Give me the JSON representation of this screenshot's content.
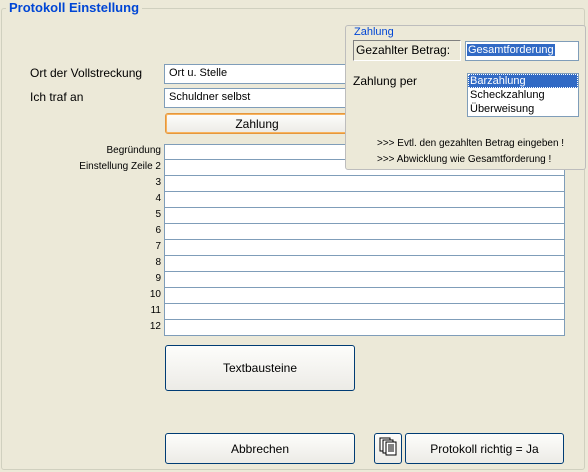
{
  "frame": {
    "title": "Protokoll Einstellung"
  },
  "form": {
    "ort_label": "Ort der Vollstreckung",
    "ort_value": "Ort u. Stelle",
    "traf_label": "Ich traf an",
    "traf_value": "Schuldner selbst",
    "zahlung_button": "Zahlung"
  },
  "lines": {
    "labels": [
      "Begründung",
      "Einstellung Zeile 2",
      "3",
      "4",
      "5",
      "6",
      "7",
      "8",
      "9",
      "10",
      "11",
      "12"
    ]
  },
  "buttons": {
    "textbausteine": "Textbausteine",
    "abbrechen": "Abbrechen",
    "protokoll": "Protokoll richtig = Ja"
  },
  "popup": {
    "title": "Zahlung",
    "betrag_label": "Gezahlter Betrag:",
    "betrag_value": "Gesamtforderung",
    "per_label": "Zahlung per",
    "options": [
      "Barzahlung",
      "Scheckzahlung",
      "Überweisung"
    ],
    "selected": "Barzahlung",
    "hint1": ">>> Evtl. den gezahlten Betrag eingeben !",
    "hint2": ">>> Abwicklung wie Gesamtforderung !"
  },
  "icons": {
    "copy": "copy-pages-icon"
  }
}
